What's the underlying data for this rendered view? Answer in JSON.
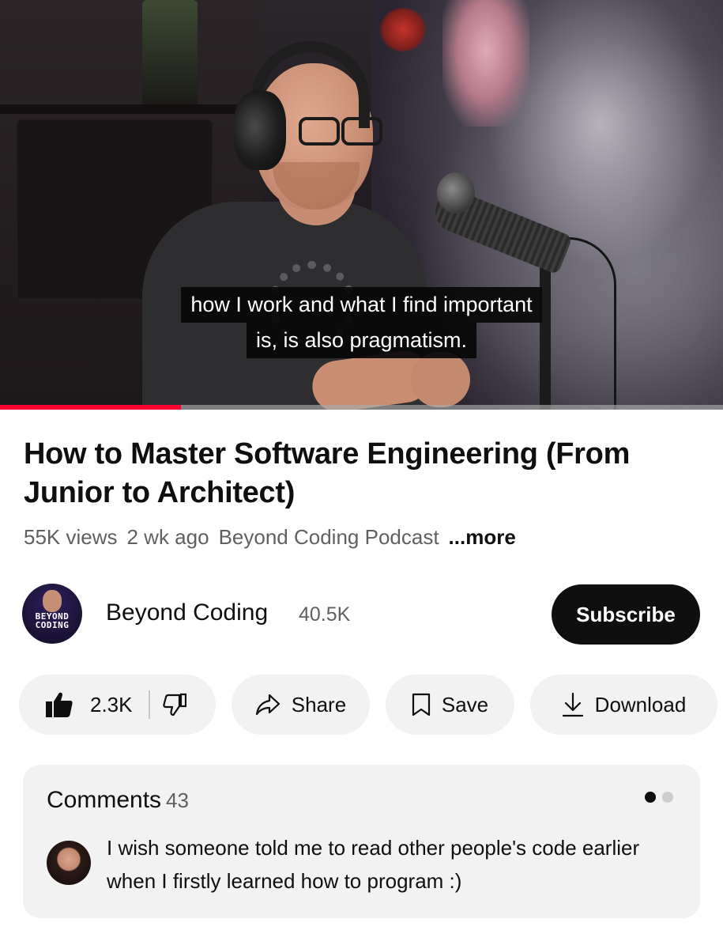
{
  "video": {
    "caption_line1": "how I work and what I find important",
    "caption_line2": "is, is also pragmatism.",
    "progress": 0.25
  },
  "details": {
    "title": "How to Master Software Engineering (From Junior to Architect)",
    "views": "55K views",
    "age": "2 wk ago",
    "channel_meta": "Beyond Coding Podcast",
    "more_label": "...more"
  },
  "channel": {
    "avatar_text_line1": "BEYOND",
    "avatar_text_line2": "CODING",
    "name": "Beyond Coding",
    "subscribers": "40.5K",
    "subscribe_label": "Subscribe"
  },
  "actions": {
    "like_count": "2.3K",
    "share_label": "Share",
    "save_label": "Save",
    "download_label": "Download"
  },
  "comments": {
    "title": "Comments",
    "count": "43",
    "top_comment": "I wish someone told me to read other people's code earlier when I firstly learned how to program :)"
  },
  "icons": {
    "like": "thumb-up-icon",
    "dislike": "thumb-down-icon",
    "share": "share-arrow-icon",
    "save": "bookmark-icon",
    "download": "download-arrow-icon"
  },
  "colors": {
    "progress": "#ff0033",
    "subscribe_bg": "#0f0f0f",
    "pill_bg": "#f2f2f2",
    "text_secondary": "#606060"
  }
}
